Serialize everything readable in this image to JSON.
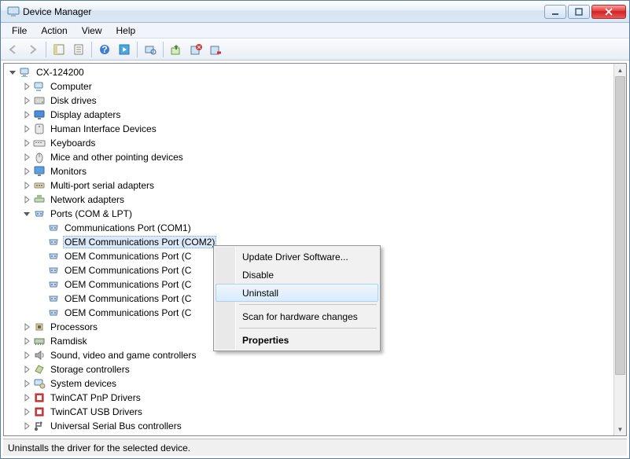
{
  "window": {
    "title": "Device Manager"
  },
  "menu": {
    "items": [
      "File",
      "Action",
      "View",
      "Help"
    ]
  },
  "root": {
    "name": "CX-124200"
  },
  "categories": [
    {
      "label": "Computer",
      "icon": "computer"
    },
    {
      "label": "Disk drives",
      "icon": "disk"
    },
    {
      "label": "Display adapters",
      "icon": "display"
    },
    {
      "label": "Human Interface Devices",
      "icon": "hid"
    },
    {
      "label": "Keyboards",
      "icon": "keyboard"
    },
    {
      "label": "Mice and other pointing devices",
      "icon": "mouse"
    },
    {
      "label": "Monitors",
      "icon": "monitor"
    },
    {
      "label": "Multi-port serial adapters",
      "icon": "serial"
    },
    {
      "label": "Network adapters",
      "icon": "network"
    }
  ],
  "ports": {
    "label": "Ports (COM & LPT)",
    "icon": "ports"
  },
  "port_children": [
    {
      "label": "Communications Port (COM1)",
      "sel": false
    },
    {
      "label": "OEM Communications Port (COM2)",
      "sel": true
    },
    {
      "label": "OEM Communications Port (C",
      "sel": false
    },
    {
      "label": "OEM Communications Port (C",
      "sel": false
    },
    {
      "label": "OEM Communications Port (C",
      "sel": false
    },
    {
      "label": "OEM Communications Port (C",
      "sel": false
    },
    {
      "label": "OEM Communications Port (C",
      "sel": false
    }
  ],
  "categories2": [
    {
      "label": "Processors",
      "icon": "cpu"
    },
    {
      "label": "Ramdisk",
      "icon": "ram"
    },
    {
      "label": "Sound, video and game controllers",
      "icon": "sound"
    },
    {
      "label": "Storage controllers",
      "icon": "storage"
    },
    {
      "label": "System devices",
      "icon": "system"
    },
    {
      "label": "TwinCAT PnP Drivers",
      "icon": "twincat"
    },
    {
      "label": "TwinCAT USB Drivers",
      "icon": "twincat"
    },
    {
      "label": "Universal Serial Bus controllers",
      "icon": "usb"
    }
  ],
  "context": {
    "items": [
      {
        "label": "Update Driver Software...",
        "type": "item"
      },
      {
        "label": "Disable",
        "type": "item"
      },
      {
        "label": "Uninstall",
        "type": "item",
        "hover": true
      },
      {
        "type": "sep"
      },
      {
        "label": "Scan for hardware changes",
        "type": "item"
      },
      {
        "type": "sep"
      },
      {
        "label": "Properties",
        "type": "item",
        "bold": true
      }
    ]
  },
  "status": "Uninstalls the driver for the selected device."
}
